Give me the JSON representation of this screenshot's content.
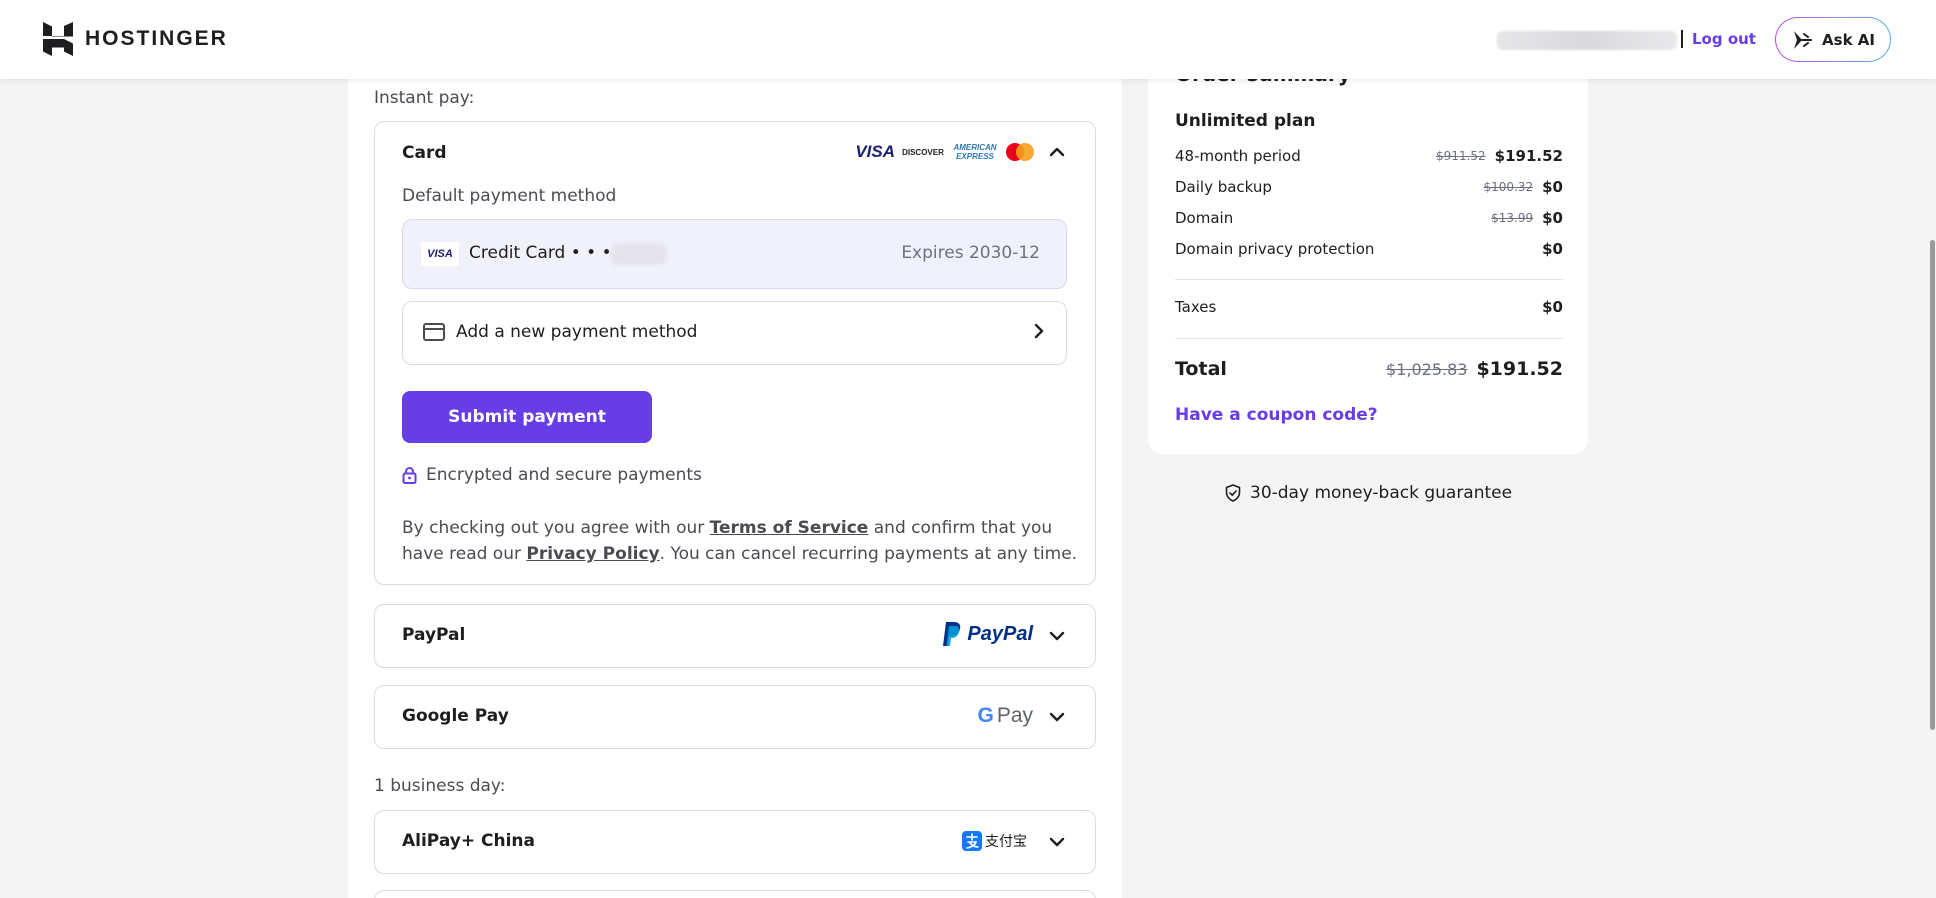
{
  "header": {
    "brand": "HOSTINGER",
    "logout": "Log out",
    "ask_ai": "Ask AI"
  },
  "payment": {
    "instant_label": "Instant pay:",
    "card": {
      "title": "Card",
      "default_label": "Default payment method",
      "saved_card_name": "Credit Card • • • •",
      "saved_card_brand": "VISA",
      "expires": "Expires 2030-12",
      "add_method": "Add a new payment method",
      "submit": "Submit payment",
      "secure": "Encrypted and secure payments",
      "legal_1": "By checking out you agree with our ",
      "terms": "Terms of Service",
      "legal_2": " and confirm that you have read our ",
      "privacy": "Privacy Policy",
      "legal_3": ". You can cancel recurring payments at any time."
    },
    "paypal": {
      "title": "PayPal",
      "logo": "PayPal"
    },
    "google_pay": {
      "title": "Google Pay",
      "logo_g": "G",
      "logo_pay": "Pay"
    },
    "business_label": "1 business day:",
    "alipay": {
      "title": "AliPay+ China",
      "logo": "支付宝"
    },
    "brands": [
      "VISA",
      "DISCOVER",
      "AMERICAN EXPRESS",
      "Mastercard"
    ]
  },
  "summary": {
    "title": "Order summary",
    "plan": "Unlimited plan",
    "rows": [
      {
        "label": "48-month period",
        "old": "$911.52",
        "new": "$191.52"
      },
      {
        "label": "Daily backup",
        "old": "$100.32",
        "new": "$0"
      },
      {
        "label": "Domain",
        "old": "$13.99",
        "new": "$0"
      },
      {
        "label": "Domain privacy protection",
        "old": "",
        "new": "$0"
      }
    ],
    "taxes": {
      "label": "Taxes",
      "value": "$0"
    },
    "total": {
      "label": "Total",
      "old": "$1,025.83",
      "new": "$191.52"
    },
    "coupon": "Have a coupon code?",
    "guarantee": "30-day money-back guarantee"
  },
  "colors": {
    "accent": "#673de6",
    "text": "#1d1e20",
    "muted": "#4b4b52"
  }
}
